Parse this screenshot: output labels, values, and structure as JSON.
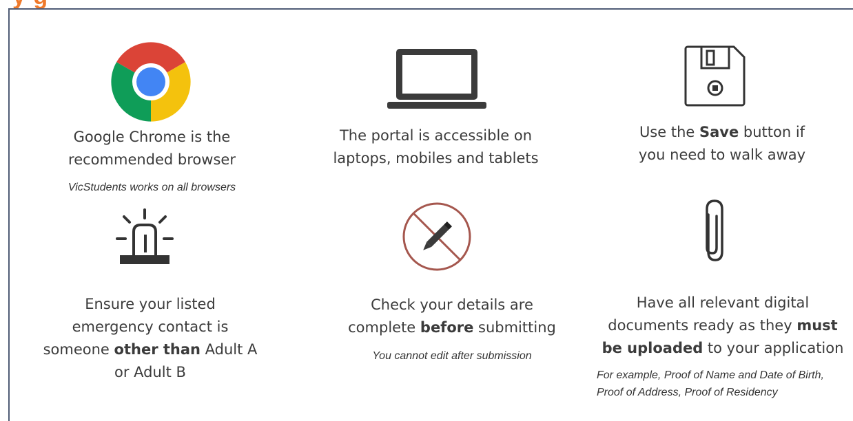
{
  "header": {
    "title_fragment": "y  g"
  },
  "tips": [
    {
      "icon": "chrome-logo-icon",
      "main": "Google Chrome is the recommended browser",
      "note": "VicStudents works on all browsers"
    },
    {
      "icon": "laptop-icon",
      "main": "The portal is accessible on laptops, mobiles and tablets"
    },
    {
      "icon": "floppy-disk-save-icon",
      "main_pre": "Use the ",
      "main_bold": "Save",
      "main_post": " button if you need to walk away"
    },
    {
      "icon": "emergency-siren-icon",
      "main_pre": "Ensure your listed emergency contact is someone ",
      "main_bold": "other than",
      "main_post": " Adult A or Adult B"
    },
    {
      "icon": "no-editing-pencil-icon",
      "main_pre": "Check your details are complete ",
      "main_bold": "before",
      "main_post": " submitting",
      "note": "You cannot edit after submission"
    },
    {
      "icon": "paperclip-icon",
      "main_pre": "Have all relevant digital documents ready as they ",
      "main_bold": "must be uploaded",
      "main_post": " to your application",
      "note": "For example, Proof of Name and Date of Birth, Proof of Address, Proof of Residency"
    }
  ],
  "colors": {
    "title": "#ef7a2c",
    "frame": "#4f5c76",
    "no_sign": "#a5574e"
  }
}
